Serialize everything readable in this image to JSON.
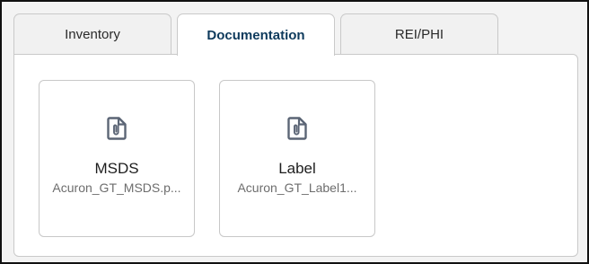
{
  "tabs": [
    {
      "label": "Inventory",
      "active": false
    },
    {
      "label": "Documentation",
      "active": true
    },
    {
      "label": "REI/PHI",
      "active": false
    }
  ],
  "documents": [
    {
      "title": "MSDS",
      "filename": "Acuron_GT_MSDS.p...",
      "icon": "paperclip-file-icon"
    },
    {
      "title": "Label",
      "filename": "Acuron_GT_Label1...",
      "icon": "paperclip-file-icon"
    }
  ],
  "colors": {
    "active_tab_text": "#0e3a5c",
    "icon": "#5b6575",
    "border": "#c9c9c9"
  }
}
